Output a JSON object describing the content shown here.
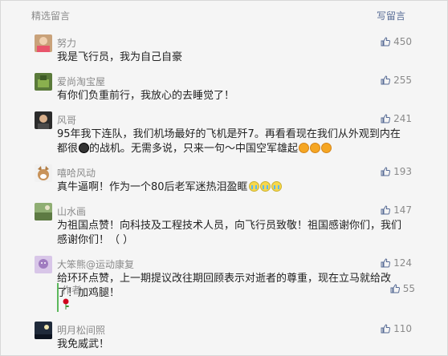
{
  "header": {
    "title": "精选留言",
    "write_label": "写留言"
  },
  "comments": [
    {
      "nick": "努力",
      "likes": "450",
      "content": "我是飞行员，我为自己自豪"
    },
    {
      "nick": "爱尚淘宝屋",
      "likes": "255",
      "content": "有你们负重前行，我放心的去睡觉了！"
    },
    {
      "nick": "风哥",
      "likes": "241",
      "content_a": "95年我下连队，我们机场最好的飞机是歼7。再看看现在我们从外观到内在都很",
      "content_b": "的战机。无需多说，只来一句～中国空军雄起"
    },
    {
      "nick": "嘻哈风动",
      "likes": "193",
      "content": "真牛逼啊！作为一个80后老军迷热泪盈眶"
    },
    {
      "nick": "山水画",
      "likes": "147",
      "content": "为祖国点赞！向科技及工程技术人员，向飞行员致敬！祖国感谢你们，我们感谢你们！（ ）"
    },
    {
      "nick": "大笨熊@运动康复",
      "likes": "124",
      "content": "给环环点赞，上一期提议改往期回顾表示对逝者的尊重，现在立马就给改了！加鸡腿！",
      "reply": {
        "author_label": "作者",
        "likes": "55"
      }
    },
    {
      "nick": "明月松间照",
      "likes": "110",
      "content": "我免威武！"
    }
  ],
  "icons": {
    "like": "thumbs-up-icon",
    "rose": "rose-icon",
    "emoji_fist": "fist-emoji-icon",
    "emoji_cry": "crying-emoji-icon",
    "emoji_cool": "cool-emoji-icon"
  },
  "colors": {
    "link": "#576b95",
    "meta": "#8a8a8a",
    "text": "#222222",
    "reply_bar": "#5cb85c"
  }
}
